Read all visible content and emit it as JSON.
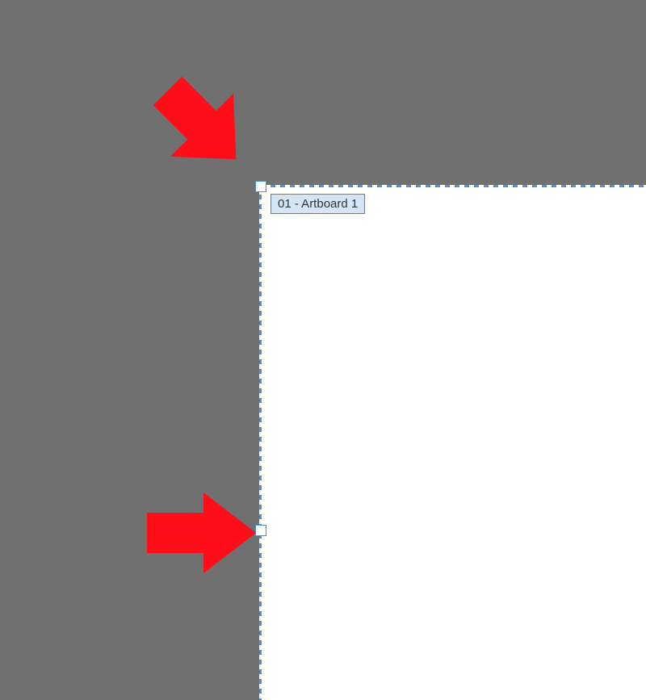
{
  "artboard": {
    "label": "01 - Artboard 1"
  },
  "colors": {
    "canvas_background": "#707070",
    "artboard_fill": "#ffffff",
    "selection_blue": "#4a90d9",
    "label_background": "#d4e5f7",
    "annotation_red": "#ff0e1a"
  },
  "annotations": {
    "arrow_top": "pointer-arrow-to-corner-handle",
    "arrow_mid": "pointer-arrow-to-midpoint-handle"
  }
}
